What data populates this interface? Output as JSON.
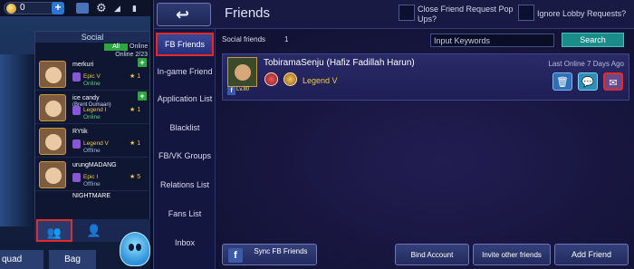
{
  "left": {
    "gold": "0",
    "social_title": "Social",
    "filter_all": "All",
    "filter_online": "Online",
    "online_count": "Online 2/23",
    "friends": [
      {
        "name": "merkuri",
        "sub": "",
        "rank": "Epic V",
        "stars": "★ 1",
        "status": "Online",
        "online": true,
        "add": "+"
      },
      {
        "name": "ice candy",
        "sub": "(Brent Dumaan)",
        "rank": "Legend I",
        "stars": "★ 1",
        "status": "Online",
        "online": true,
        "add": "+"
      },
      {
        "name": "RYtik",
        "sub": "",
        "rank": "Legend V",
        "stars": "★ 1",
        "status": "Offline",
        "online": false,
        "add": ""
      },
      {
        "name": "urungMADANG",
        "sub": "",
        "rank": "Epic I",
        "stars": "★ 5",
        "status": "Offline",
        "online": false,
        "add": ""
      }
    ],
    "partial_name": "NIGHTMARE",
    "bottom_squad": "quad",
    "bottom_bag": "Bag"
  },
  "header": {
    "title": "Friends",
    "close_popups_label": "Close Friend Request Pop Ups?",
    "ignore_lobby_label": "Ignore Lobby Requests?"
  },
  "nav": {
    "items": [
      {
        "label": "FB Friends",
        "active": true
      },
      {
        "label": "In-game Friend",
        "active": false
      },
      {
        "label": "Application List",
        "active": false
      },
      {
        "label": "Blacklist",
        "active": false
      },
      {
        "label": "FB/VK Groups",
        "active": false
      },
      {
        "label": "Relations List",
        "active": false
      },
      {
        "label": "Fans List",
        "active": false
      },
      {
        "label": "Inbox",
        "active": false
      }
    ]
  },
  "content": {
    "social_friends_label": "Social friends",
    "social_friends_count": "1",
    "search_placeholder": "Input Keywords",
    "search_button": "Search",
    "friend": {
      "name": "TobiramaSenju (Hafiz Fadillah Harun)",
      "level": "Lv.80",
      "rank": "Legend V",
      "last_online": "Last Online 7 Days Ago"
    }
  },
  "bottom": {
    "sync_label": "Sync FB Friends",
    "bind_label": "Bind Account",
    "invite_label": "Invite other friends",
    "add_label": "Add Friend"
  },
  "colors": {
    "accent_red": "#e52a2a",
    "search_teal": "#1c8c8a",
    "online_green": "#59d27a",
    "rank_gold": "#f2c84a"
  },
  "icons": [
    "back-arrow-icon",
    "gold-coin-icon",
    "mail-icon",
    "gear-icon",
    "wifi-icon",
    "delete-icon",
    "chat-icon",
    "gift-icon",
    "facebook-icon",
    "friends-icon",
    "add-friend-icon"
  ]
}
